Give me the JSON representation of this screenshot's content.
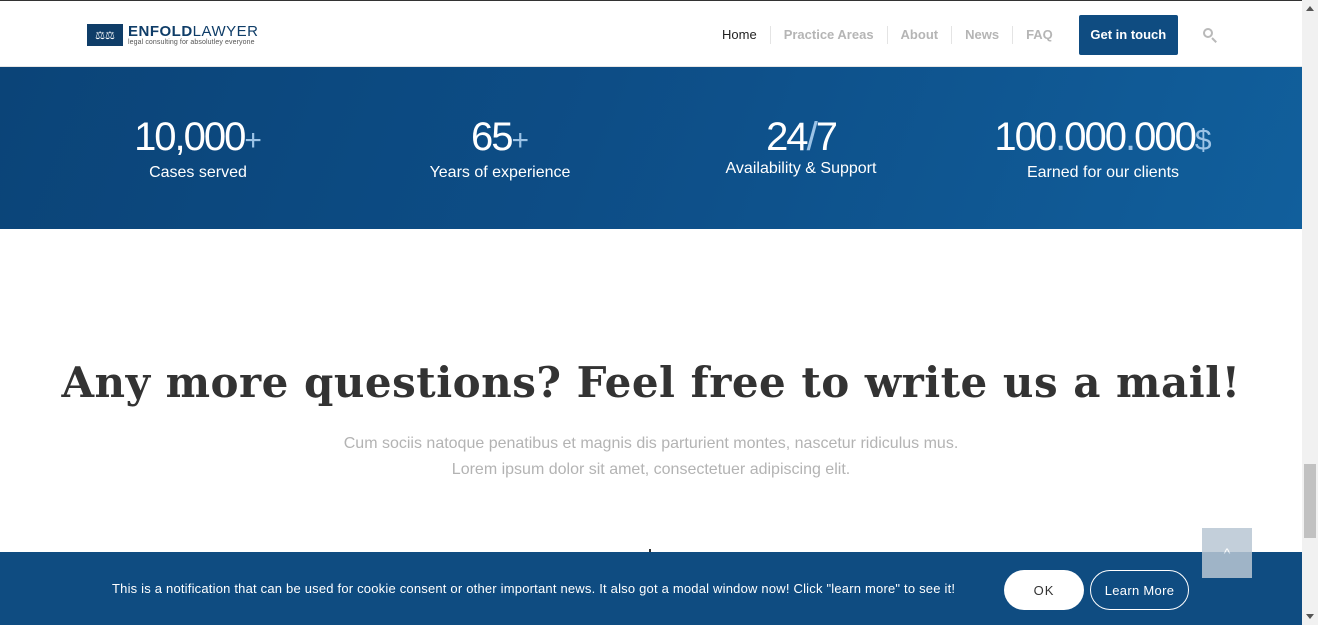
{
  "header": {
    "logo": {
      "mark": "⚖⚖",
      "brand_bold": "ENFOLD",
      "brand_light": "LAWYER",
      "tagline": "legal consulting for absolutley everyone"
    },
    "nav": [
      {
        "label": "Home"
      },
      {
        "label": "Practice Areas"
      },
      {
        "label": "About"
      },
      {
        "label": "News"
      },
      {
        "label": "FAQ"
      }
    ],
    "cta_label": "Get in touch",
    "search_icon": "search-icon"
  },
  "stats": [
    {
      "number": "10,000",
      "suffix": "+",
      "label": "Cases served"
    },
    {
      "number": "65",
      "suffix": "+",
      "label": "Years of experience"
    },
    {
      "number_a": "24",
      "sep": "/",
      "number_b": "7",
      "label": "Availability & Support"
    },
    {
      "p1": "100",
      "d1": ".",
      "p2": "000",
      "d2": ".",
      "p3": "000",
      "suffix": "$",
      "label": "Earned for our clients"
    }
  ],
  "questions": {
    "title": "Any more questions? Feel free to write us a mail!",
    "line1": "Cum sociis natoque penatibus et magnis dis parturient montes, nascetur ridiculus mus.",
    "line2": "Lorem ipsum dolor sit amet, consectetuer adipiscing elit."
  },
  "cookie": {
    "text": "This is a notification that can be used for cookie consent or other important news. It also got a modal window now! Click \"learn more\" to see it!",
    "ok_label": "OK",
    "learn_label": "Learn More"
  },
  "to_top_icon": "^",
  "colors": {
    "brand": "#0f4c81",
    "accent_light": "#9cc3e6"
  }
}
